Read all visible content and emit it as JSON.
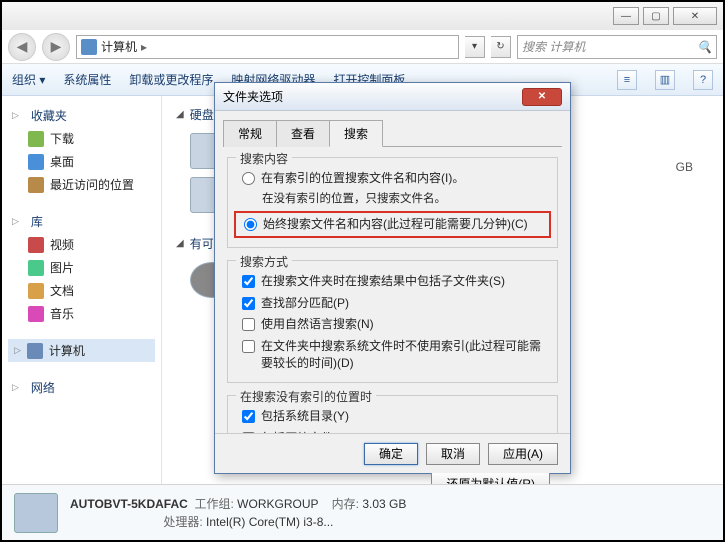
{
  "window": {
    "min": "—",
    "max": "▢",
    "close": "✕"
  },
  "nav": {
    "back": "◀",
    "fwd": "▶",
    "crumb1": "计算机",
    "sep": "▸",
    "refresh": "↻",
    "dropdown": "▾",
    "search_placeholder": "搜索 计算机"
  },
  "toolbar": {
    "organize": "组织 ▾",
    "props": "系统属性",
    "uninstall": "卸载或更改程序",
    "map": "映射网络驱动器",
    "ctrlpanel": "打开控制面板",
    "view": "≡",
    "pane": "▥",
    "help": "?"
  },
  "sidebar": {
    "fav": "收藏夹",
    "fav_items": [
      "下载",
      "桌面",
      "最近访问的位置"
    ],
    "lib": "库",
    "lib_items": [
      "视频",
      "图片",
      "文档",
      "音乐"
    ],
    "computer": "计算机",
    "network": "网络"
  },
  "content": {
    "section_hdd": "硬盘 (",
    "section_removable": "有可移",
    "size_hint": "GB"
  },
  "dialog": {
    "title": "文件夹选项",
    "close": "✕",
    "tabs": {
      "general": "常规",
      "view": "查看",
      "search": "搜索"
    },
    "grp1": {
      "label": "搜索内容",
      "r1": "在有索引的位置搜索文件名和内容(I)。",
      "r1b": "在没有索引的位置，只搜索文件名。",
      "r2": "始终搜索文件名和内容(此过程可能需要几分钟)(C)"
    },
    "grp2": {
      "label": "搜索方式",
      "c1": "在搜索文件夹时在搜索结果中包括子文件夹(S)",
      "c2": "查找部分匹配(P)",
      "c3": "使用自然语言搜索(N)",
      "c4": "在文件夹中搜索系统文件时不使用索引(此过程可能需要较长的时间)(D)"
    },
    "grp3": {
      "label": "在搜索没有索引的位置时",
      "c1": "包括系统目录(Y)",
      "c2": "包括压缩文件(ZIP、CAB...)(Z)"
    },
    "restore": "还原为默认值(R)",
    "ok": "确定",
    "cancel": "取消",
    "apply": "应用(A)"
  },
  "status": {
    "name": "AUTOBVT-5KDAFAC",
    "wg_label": "工作组:",
    "wg": "WORKGROUP",
    "mem_label": "内存:",
    "mem": "3.03 GB",
    "cpu_label": "处理器:",
    "cpu": "Intel(R) Core(TM) i3-8..."
  }
}
